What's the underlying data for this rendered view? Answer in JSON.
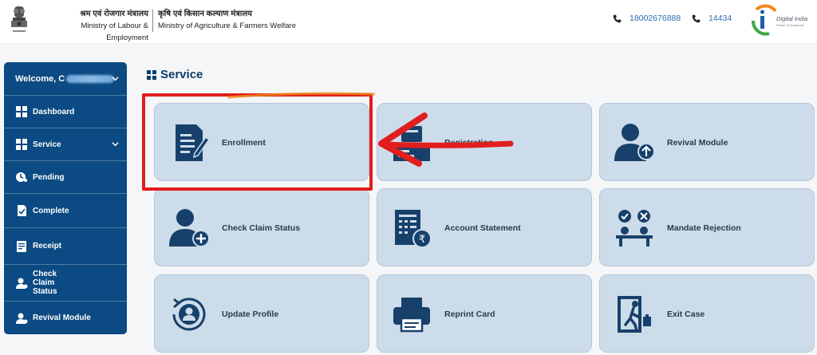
{
  "header": {
    "ministry1_hindi": "श्रम एवं रोजगार मंत्रालय",
    "ministry1_english": "Ministry of Labour & Employment",
    "ministry2_hindi": "कृषि एवं किसान कल्याण मंत्रालय",
    "ministry2_english": "Ministry of Agriculture & Farmers Welfare",
    "phone1": "18002676888",
    "phone2": "14434",
    "logo_text": "Digital India",
    "logo_tagline": "Power To Empower"
  },
  "sidebar": {
    "welcome": "Welcome, C",
    "items": [
      {
        "label": "Dashboard",
        "icon": "dashboard-icon"
      },
      {
        "label": "Service",
        "icon": "grid-icon"
      },
      {
        "label": "Pending",
        "icon": "clock-icon"
      },
      {
        "label": "Complete",
        "icon": "check-doc-icon"
      },
      {
        "label": "Receipt",
        "icon": "receipt-icon"
      },
      {
        "label": "Check Claim Status",
        "icon": "user-icon"
      },
      {
        "label": "Revival Module",
        "icon": "user-icon"
      }
    ]
  },
  "main": {
    "section_title": "Service",
    "cards": [
      {
        "label": "Enrollment",
        "icon": "enrollment-doc-icon"
      },
      {
        "label": "Registration",
        "icon": "registration-icon"
      },
      {
        "label": "Revival Module",
        "icon": "user-upload-icon"
      },
      {
        "label": "Check Claim Status",
        "icon": "user-add-icon"
      },
      {
        "label": "Account Statement",
        "icon": "statement-rupee-icon"
      },
      {
        "label": "Mandate Rejection",
        "icon": "mandate-icon"
      },
      {
        "label": "Update Profile",
        "icon": "profile-refresh-icon"
      },
      {
        "label": "Reprint Card",
        "icon": "printer-icon"
      },
      {
        "label": "Exit Case",
        "icon": "exit-door-icon"
      }
    ]
  },
  "colors": {
    "sidebar_bg": "#0b4a82",
    "card_bg": "#cddcea",
    "icon_color": "#17406b",
    "annotation_red": "#e11d1d"
  }
}
